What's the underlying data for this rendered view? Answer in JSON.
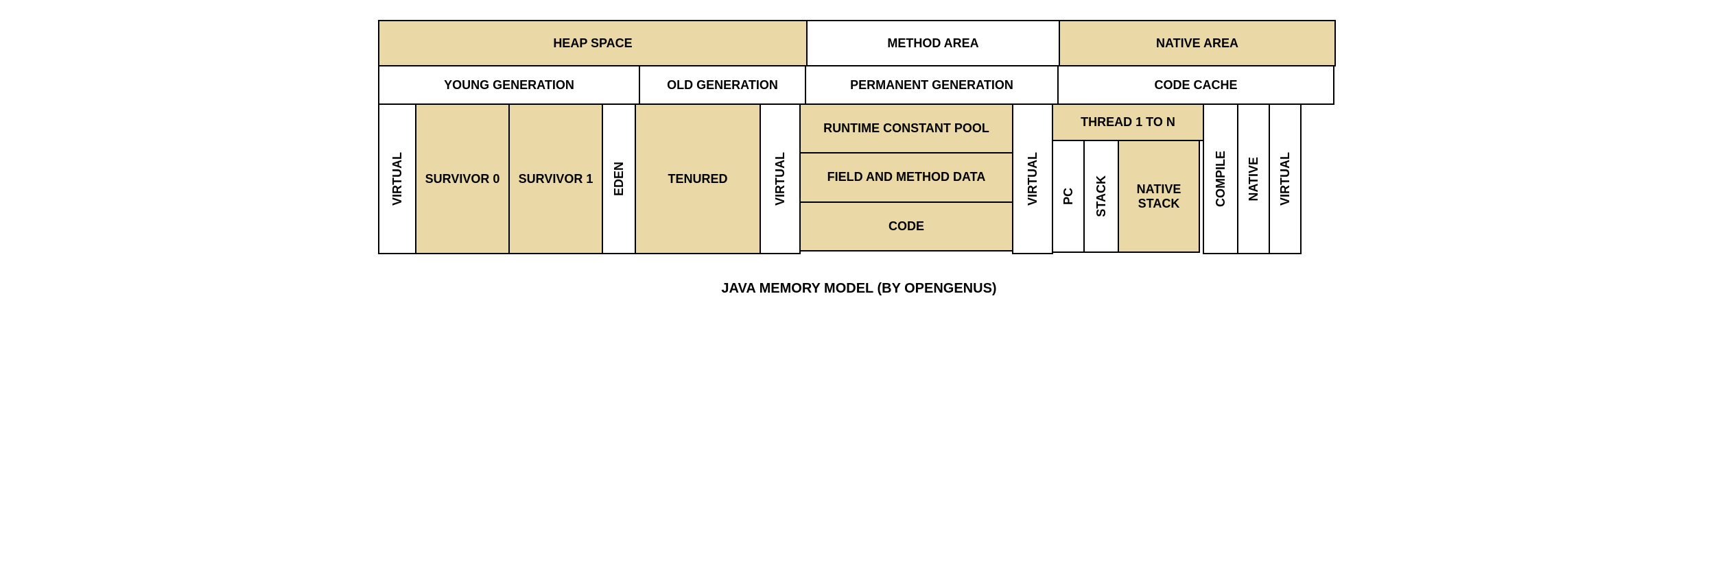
{
  "top": {
    "heap": "HEAP SPACE",
    "method": "METHOD AREA",
    "native": "NATIVE AREA"
  },
  "sub": {
    "young": "YOUNG GENERATION",
    "old": "OLD GENERATION",
    "perm": "PERMANENT GENERATION",
    "code_cache": "CODE CACHE"
  },
  "body": {
    "virtual": "VIRTUAL",
    "survivor0": "SURVIVOR 0",
    "survivor1": "SURVIVOR 1",
    "eden": "EDEN",
    "tenured": "TENURED",
    "rcp": "RUNTIME CONSTANT POOL",
    "fmd": "FIELD AND METHOD DATA",
    "code": "CODE",
    "thread": "THREAD 1 TO N",
    "pc": "PC",
    "stack": "STACK",
    "native_stack": "NATIVE STACK",
    "compile": "COMPILE",
    "native": "NATIVE"
  },
  "caption": "JAVA MEMORY MODEL (BY OPENGENUS)"
}
